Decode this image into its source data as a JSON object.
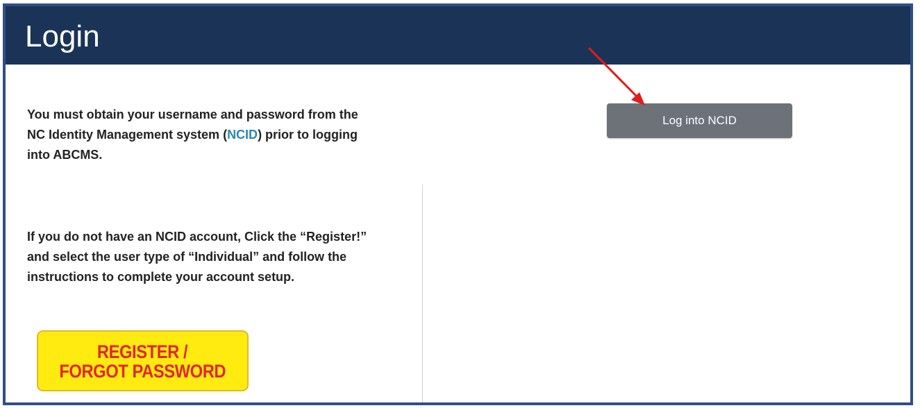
{
  "header": {
    "title": "Login"
  },
  "intro": {
    "part1": "You must obtain your username and password from the NC Identity Management system (",
    "link": "NCID",
    "part2": ") prior to logging into ABCMS."
  },
  "register_info": {
    "text": "If you do not have an NCID account, Click the “Register!” and select the user type of “Individual” and follow the instructions to complete your account setup."
  },
  "register_button": {
    "line1": "REGISTER /",
    "line2": "FORGOT PASSWORD"
  },
  "ncid_button": {
    "label": "Log into NCID"
  },
  "colors": {
    "header_bg": "#1b3356",
    "frame_border": "#2f4f86",
    "link": "#2a86b8",
    "ncid_button_bg": "#6c7278",
    "register_bg": "#ffeb10",
    "register_text": "#e3262e",
    "annotation_arrow": "#e31b1b"
  },
  "icons": {
    "annotation": "arrow-pointer-icon"
  }
}
